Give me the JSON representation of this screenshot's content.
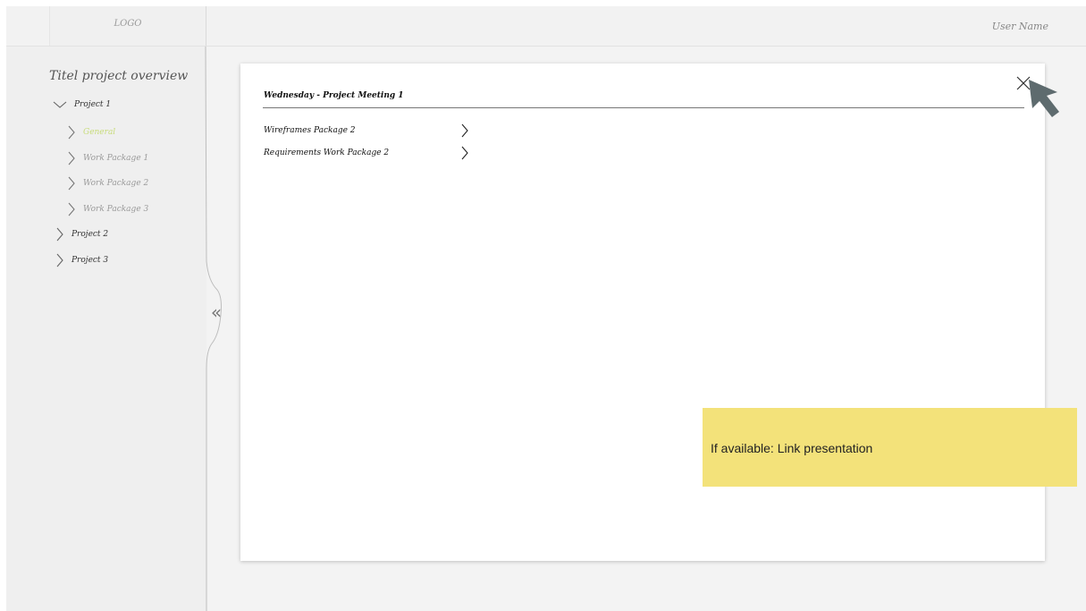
{
  "header": {
    "logo_text": "LOGO",
    "user_name": "User Name"
  },
  "sidebar": {
    "title": "Titel project overview",
    "collapse_glyph": "«",
    "tree": [
      {
        "label": "Project 1",
        "expanded": true,
        "icon": "chevron-down-icon"
      },
      {
        "label": "General",
        "state": "active",
        "icon": "chevron-right-icon"
      },
      {
        "label": "Work Package 1",
        "icon": "chevron-right-icon"
      },
      {
        "label": "Work Package 2",
        "icon": "chevron-right-icon"
      },
      {
        "label": "Work Package 3",
        "icon": "chevron-right-icon"
      },
      {
        "label": "Project 2",
        "icon": "chevron-right-icon"
      },
      {
        "label": "Project 3",
        "icon": "chevron-right-icon"
      }
    ]
  },
  "panel": {
    "title": "Wednesday - Project Meeting 1",
    "rows": [
      {
        "label": "Wireframes Package 2",
        "icon": "chevron-right-icon"
      },
      {
        "label": "Requirements Work Package 2",
        "icon": "chevron-right-icon"
      }
    ],
    "close_icon": "close-icon"
  },
  "note": {
    "text": "If available: Link presentation",
    "color": "#f3e27a"
  },
  "colors": {
    "active_item": "#c8dc7a",
    "sidebar_bg": "#efefef"
  }
}
